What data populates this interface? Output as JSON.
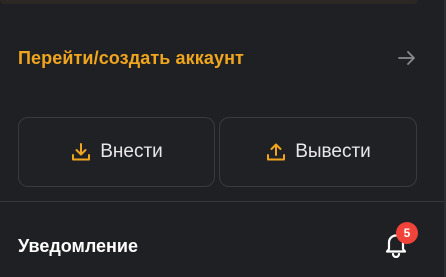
{
  "account": {
    "link_label": "Перейти/создать аккаунт",
    "arrow_icon": "arrow-right-icon"
  },
  "actions": {
    "deposit_label": "Внести",
    "deposit_icon": "download-icon",
    "withdraw_label": "Вывести",
    "withdraw_icon": "upload-icon"
  },
  "notifications": {
    "label": "Уведомление",
    "bell_icon": "bell-icon",
    "count": "5"
  },
  "colors": {
    "accent": "#f0a51e",
    "badge": "#f0443a",
    "background": "#1f2023"
  }
}
